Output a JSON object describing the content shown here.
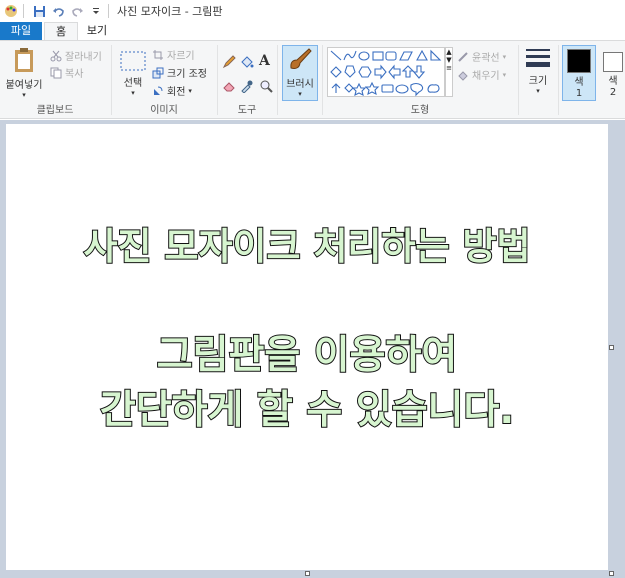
{
  "window": {
    "title": "사진 모자이크 - 그림판"
  },
  "tabs": {
    "file": "파일",
    "home": "홈",
    "view": "보기"
  },
  "clipboard": {
    "paste": "붙여넣기",
    "cut": "잘라내기",
    "copy": "복사",
    "label": "클립보드"
  },
  "image": {
    "select": "선택",
    "crop": "자르기",
    "resize": "크기 조정",
    "rotate": "회전",
    "label": "이미지"
  },
  "tools": {
    "label": "도구"
  },
  "brushes": {
    "label": "브러시"
  },
  "shapes": {
    "outline": "윤곽선",
    "fill": "채우기",
    "label": "도형"
  },
  "size": {
    "label": "크기"
  },
  "colors": {
    "color1": "색",
    "color1_num": "1",
    "color2": "색",
    "color2_num": "2",
    "color1_value": "#000000",
    "color2_value": "#ffffff"
  },
  "canvas": {
    "line1": "사진 모자이크 처리하는 방법",
    "line2": "그림판을 이용하여",
    "line3": "간단하게 할 수 있습니다."
  },
  "accent": "#1979ca"
}
